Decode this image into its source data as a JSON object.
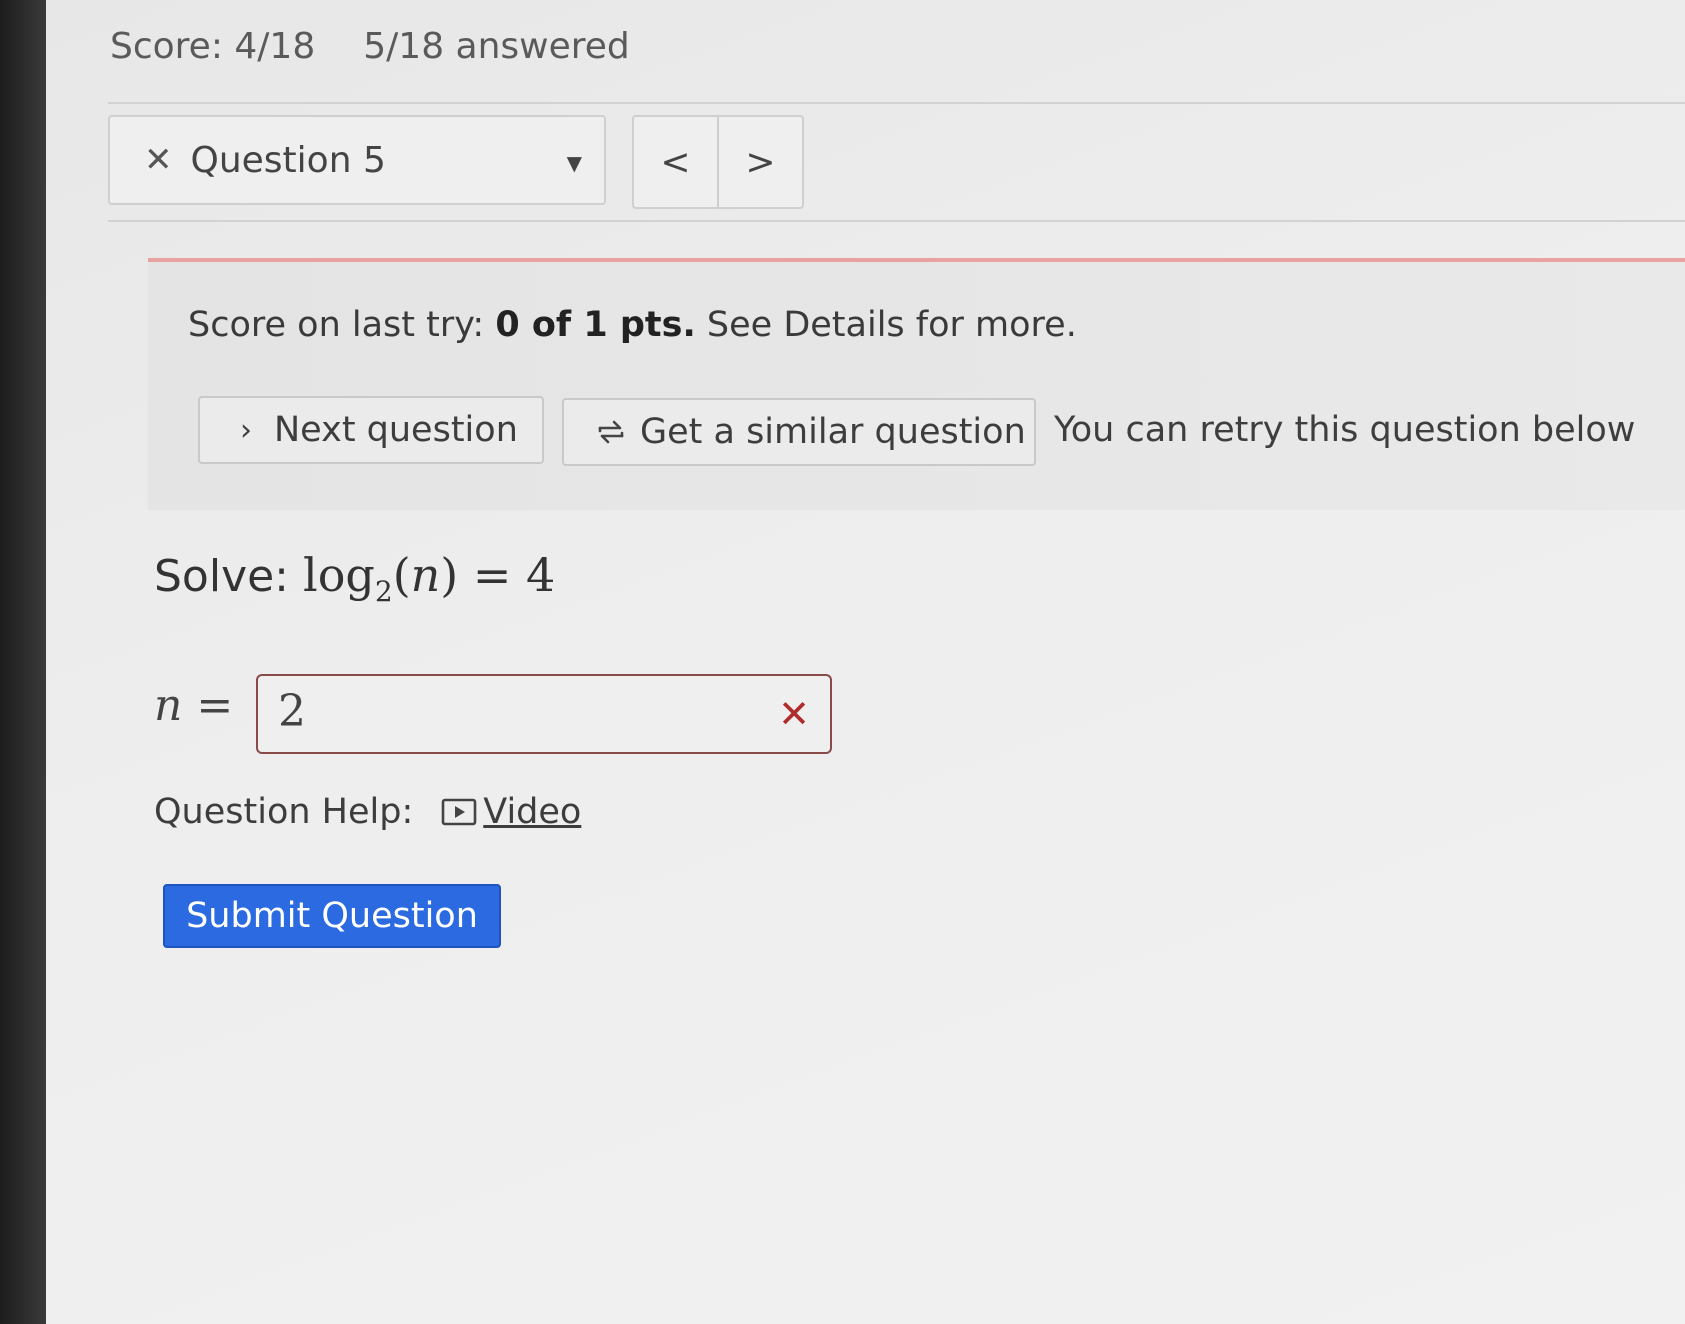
{
  "header": {
    "score": "Score: 4/18",
    "answered": "5/18 answered"
  },
  "question_nav": {
    "status_icon": "close-icon",
    "selected_question": "Question 5",
    "dropdown_icon": "caret-down-icon",
    "prev_label": "<",
    "next_label": ">"
  },
  "feedback": {
    "score_prefix": "Score on last try: ",
    "score_value": "0 of 1 pts.",
    "score_suffix": " See Details for more.",
    "next_question_label": "Next question",
    "similar_question_label": "Get a similar question",
    "retry_text": "You can retry this question below",
    "accent_color": "#e8a2a2"
  },
  "question": {
    "prompt_label": "Solve:",
    "math_func": "log",
    "math_base": "2",
    "math_arg": "n",
    "math_rhs": "4",
    "answer_var": "n",
    "answer_value": "2",
    "answer_status_icon": "wrong-x-icon",
    "answer_status_color": "#b02b2b"
  },
  "help": {
    "label": "Question Help:",
    "video_label": "Video",
    "video_icon": "video-play-icon"
  },
  "submit": {
    "label": "Submit Question",
    "color": "#2b6ae0"
  }
}
